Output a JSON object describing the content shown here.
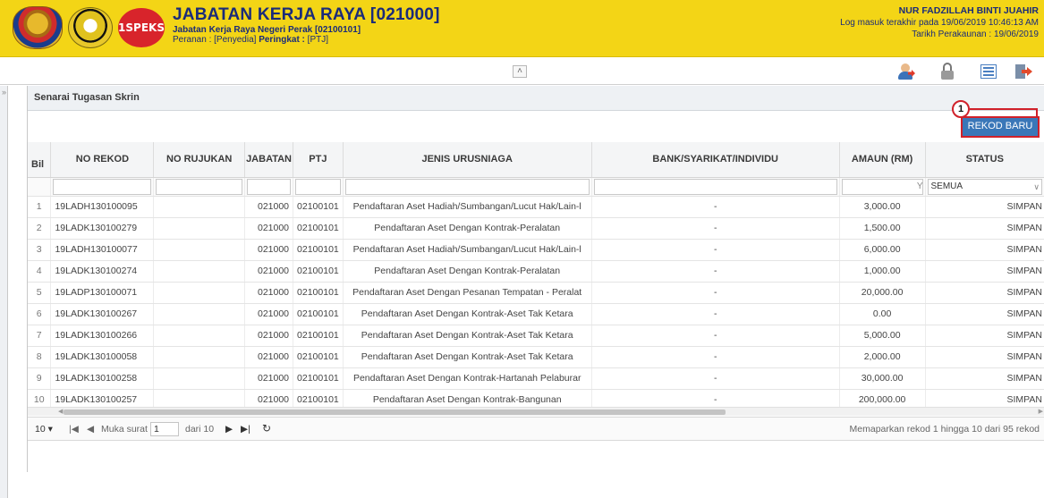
{
  "header": {
    "title": "JABATAN KERJA RAYA [021000]",
    "subtitle": "Jabatan Kerja Raya Negeri Perak [02100101]",
    "role_prefix": "Peranan : ",
    "role_value": "[Penyedia]",
    "level_prefix": " Peringkat : ",
    "level_value": "[PTJ]",
    "logo_text": "1SPEKS",
    "user_name": "NUR FADZILLAH BINTI JUAHIR",
    "last_login": "Log masuk terakhir pada 19/06/2019 10:46:13 AM",
    "accounting_date": "Tarikh Perakaunan : 19/06/2019"
  },
  "panel": {
    "title": "Senarai Tugasan Skrin",
    "new_record_button": "REKOD BARU",
    "callout_number": "1"
  },
  "table": {
    "columns": [
      "Bil",
      "NO REKOD",
      "NO RUJUKAN",
      "JABATAN",
      "PTJ",
      "JENIS URUSNIAGA",
      "BANK/SYARIKAT/INDIVIDU",
      "AMAUN (RM)",
      "STATUS"
    ],
    "status_filter": "SEMUA",
    "rows": [
      {
        "bil": "1",
        "no_rekod": "19LADH130100095",
        "no_rujukan": "",
        "jabatan": "021000",
        "ptj": "02100101",
        "jenis": "Pendaftaran Aset Hadiah/Sumbangan/Lucut Hak/Lain-l",
        "bank": "-",
        "amaun": "3,000.00",
        "status": "SIMPAN"
      },
      {
        "bil": "2",
        "no_rekod": "19LADK130100279",
        "no_rujukan": "",
        "jabatan": "021000",
        "ptj": "02100101",
        "jenis": "Pendaftaran Aset Dengan Kontrak-Peralatan",
        "bank": "-",
        "amaun": "1,500.00",
        "status": "SIMPAN"
      },
      {
        "bil": "3",
        "no_rekod": "19LADH130100077",
        "no_rujukan": "",
        "jabatan": "021000",
        "ptj": "02100101",
        "jenis": "Pendaftaran Aset Hadiah/Sumbangan/Lucut Hak/Lain-l",
        "bank": "-",
        "amaun": "6,000.00",
        "status": "SIMPAN"
      },
      {
        "bil": "4",
        "no_rekod": "19LADK130100274",
        "no_rujukan": "",
        "jabatan": "021000",
        "ptj": "02100101",
        "jenis": "Pendaftaran Aset Dengan Kontrak-Peralatan",
        "bank": "-",
        "amaun": "1,000.00",
        "status": "SIMPAN"
      },
      {
        "bil": "5",
        "no_rekod": "19LADP130100071",
        "no_rujukan": "",
        "jabatan": "021000",
        "ptj": "02100101",
        "jenis": "Pendaftaran Aset Dengan Pesanan Tempatan - Peralat",
        "bank": "-",
        "amaun": "20,000.00",
        "status": "SIMPAN"
      },
      {
        "bil": "6",
        "no_rekod": "19LADK130100267",
        "no_rujukan": "",
        "jabatan": "021000",
        "ptj": "02100101",
        "jenis": "Pendaftaran Aset Dengan Kontrak-Aset Tak Ketara",
        "bank": "-",
        "amaun": "0.00",
        "status": "SIMPAN"
      },
      {
        "bil": "7",
        "no_rekod": "19LADK130100266",
        "no_rujukan": "",
        "jabatan": "021000",
        "ptj": "02100101",
        "jenis": "Pendaftaran Aset Dengan Kontrak-Aset Tak Ketara",
        "bank": "-",
        "amaun": "5,000.00",
        "status": "SIMPAN"
      },
      {
        "bil": "8",
        "no_rekod": "19LADK130100058",
        "no_rujukan": "",
        "jabatan": "021000",
        "ptj": "02100101",
        "jenis": "Pendaftaran Aset Dengan Kontrak-Aset Tak Ketara",
        "bank": "-",
        "amaun": "2,000.00",
        "status": "SIMPAN"
      },
      {
        "bil": "9",
        "no_rekod": "19LADK130100258",
        "no_rujukan": "",
        "jabatan": "021000",
        "ptj": "02100101",
        "jenis": "Pendaftaran Aset Dengan Kontrak-Hartanah Pelaburar",
        "bank": "-",
        "amaun": "30,000.00",
        "status": "SIMPAN"
      },
      {
        "bil": "10",
        "no_rekod": "19LADK130100257",
        "no_rujukan": "",
        "jabatan": "021000",
        "ptj": "02100101",
        "jenis": "Pendaftaran Aset Dengan Kontrak-Bangunan",
        "bank": "-",
        "amaun": "200,000.00",
        "status": "SIMPAN"
      }
    ]
  },
  "pager": {
    "page_size": "10 ▾",
    "page_label": "Muka surat",
    "page_value": "1",
    "of_label": "dari 10",
    "info": "Memaparkan rekod 1 hingga 10 dari 95 rekod"
  },
  "colors": {
    "header_bg": "#f3d516",
    "header_text": "#1a2b7a",
    "button_bg": "#3a77b8",
    "highlight": "#d0212a"
  }
}
